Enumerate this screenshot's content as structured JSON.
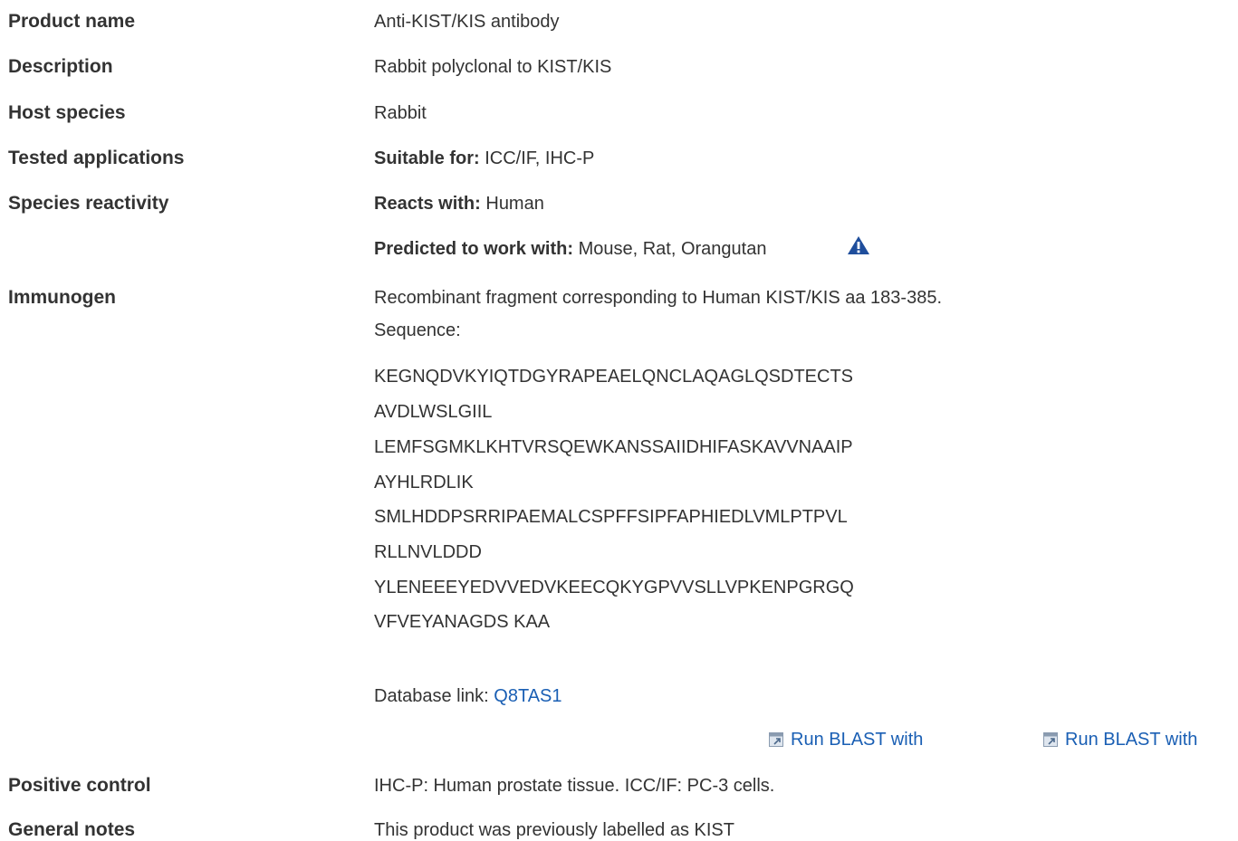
{
  "rows": {
    "product_name": {
      "label": "Product name",
      "value": "Anti-KIST/KIS antibody"
    },
    "description": {
      "label": "Description",
      "value": "Rabbit polyclonal to KIST/KIS"
    },
    "host_species": {
      "label": "Host species",
      "value": "Rabbit"
    },
    "tested_applications": {
      "label": "Tested applications",
      "prefix": "Suitable for:",
      "value": " ICC/IF, IHC-P"
    },
    "species_reactivity": {
      "label": "Species reactivity",
      "reacts_prefix": "Reacts with:",
      "reacts_value": " Human",
      "predicted_prefix": "Predicted to work with:",
      "predicted_value": " Mouse, Rat, Orangutan"
    },
    "immunogen": {
      "label": "Immunogen",
      "line1": "Recombinant fragment corresponding to Human KIST/KIS aa 183-385.",
      "sequence_label": "Sequence:",
      "sequence_lines": [
        "KEGNQDVKYIQTDGYRAPEAELQNCLAQAGLQSDTECTS",
        "AVDLWSLGIIL",
        "LEMFSGMKLKHTVRSQEWKANSSAIIDHIFASKAVVNAAIP",
        "AYHLRDLIK",
        "SMLHDDPSRRIPAEMALCSPFFSIPFAPHIEDLVMLPTPVL",
        "RLLNVLDDD",
        "YLENEEEYEDVVEDVKEECQKYGPVVSLLVPKENPGRGQ",
        "VFVEYANAGDS KAA"
      ],
      "db_prefix": "Database link: ",
      "db_link": "Q8TAS1",
      "blast_1": "Run BLAST with",
      "blast_2": "Run BLAST with"
    },
    "positive_control": {
      "label": "Positive control",
      "value": "IHC-P: Human prostate tissue. ICC/IF: PC-3 cells."
    },
    "general_notes": {
      "label": "General notes",
      "value": " This product was previously labelled as KIST"
    }
  },
  "colors": {
    "text": "#333333",
    "link": "#1a5fb4",
    "warning_icon": "#1f4e9c"
  },
  "icons": {
    "warning": "warning-triangle-icon",
    "blast": "external-window-icon"
  }
}
